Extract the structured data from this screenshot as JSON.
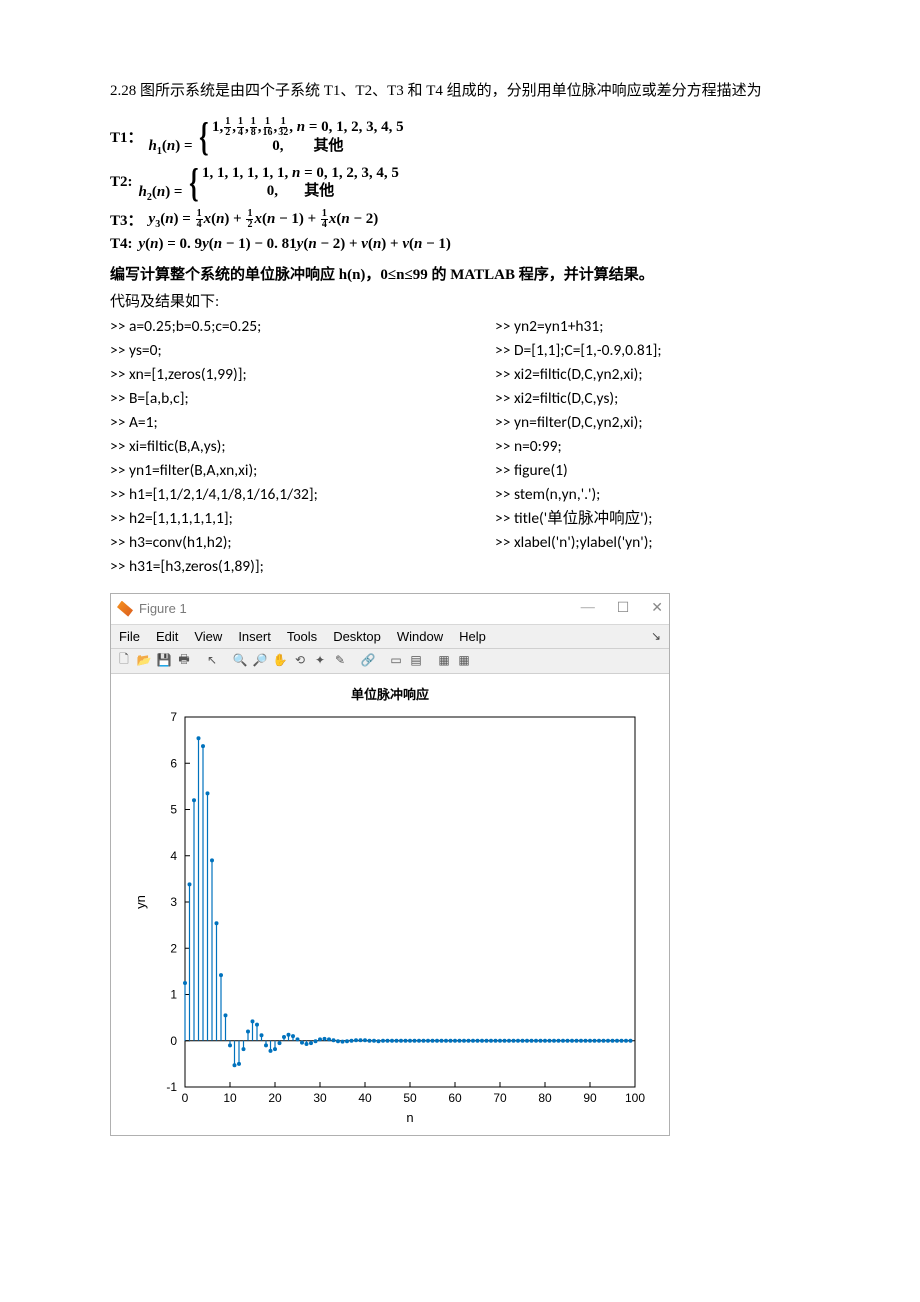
{
  "problem": {
    "statement": "2.28 图所示系统是由四个子系统 T1、T2、T3 和 T4 组成的，分别用单位脉冲响应或差分方程描述为",
    "T1_label": "T1：",
    "T1_lhs": "h₁(n) = ",
    "T1_case1": "1, ½, ¼, ⅛, 1⁄16, 1⁄32,  n = 0, 1, 2, 3, 4, 5",
    "T1_case2": "0,        其他",
    "T2_label": "T2:",
    "T2_lhs": "h₂(n) = ",
    "T2_case1": "1, 1, 1, 1, 1, 1,  n = 0, 1, 2, 3, 4, 5",
    "T2_case2": "0,        其他",
    "T3_label": "T3：",
    "T3_body": "y₃(n) = ¼x(n) + ½x(n − 1) + ¼x(n − 2)",
    "T4_label": "T4:",
    "T4_body": "y(n) = 0.9y(n − 1) − 0.81y(n − 2) + v(n) + v(n − 1)",
    "task1": "编写计算整个系统的单位脉冲响应 h(n)，0≤n≤99 的 MATLAB 程序，并计算结果。",
    "task2": "代码及结果如下:"
  },
  "code_left": [
    ">> a=0.25;b=0.5;c=0.25;",
    ">> ys=0;",
    ">> xn=[1,zeros(1,99)];",
    ">> B=[a,b,c];",
    ">> A=1;",
    ">> xi=filtic(B,A,ys);",
    ">> yn1=filter(B,A,xn,xi);",
    ">> h1=[1,1/2,1/4,1/8,1/16,1/32];",
    ">> h2=[1,1,1,1,1,1];",
    ">> h3=conv(h1,h2);",
    ">> h31=[h3,zeros(1,89)];"
  ],
  "code_right": [
    ">> yn2=yn1+h31;",
    ">> D=[1,1];C=[1,-0.9,0.81];",
    ">> xi2=filtic(D,C,yn2,xi);",
    ">> xi2=filtic(D,C,ys);",
    ">> yn=filter(D,C,yn2,xi);",
    ">> n=0:99;",
    ">> figure(1)",
    ">> stem(n,yn,'.');",
    ">> title('单位脉冲响应');",
    ">> xlabel('n');ylabel('yn');"
  ],
  "figure": {
    "window_title": "Figure 1",
    "menus": [
      "File",
      "Edit",
      "View",
      "Insert",
      "Tools",
      "Desktop",
      "Window",
      "Help"
    ],
    "toolbar_icons": [
      "new-file-icon",
      "open-icon",
      "save-icon",
      "print-icon",
      "arrow-icon",
      "zoom-in-icon",
      "zoom-out-icon",
      "pan-icon",
      "rotate-icon",
      "data-cursor-icon",
      "brush-icon",
      "link-icon",
      "colorbar-icon",
      "legend-icon",
      "sep",
      "layout-icon",
      "layout2-icon"
    ],
    "plot_title": "单位脉冲响应",
    "xlabel": "n",
    "ylabel": "yn"
  },
  "chart_data": {
    "type": "stem",
    "title": "单位脉冲响应",
    "xlabel": "n",
    "ylabel": "yn",
    "xlim": [
      0,
      100
    ],
    "ylim": [
      -1,
      7
    ],
    "xticks": [
      0,
      10,
      20,
      30,
      40,
      50,
      60,
      70,
      80,
      90,
      100
    ],
    "yticks": [
      -1,
      0,
      1,
      2,
      3,
      4,
      5,
      6,
      7
    ],
    "x": [
      0,
      1,
      2,
      3,
      4,
      5,
      6,
      7,
      8,
      9,
      10,
      11,
      12,
      13,
      14,
      15,
      16,
      17,
      18,
      19,
      20,
      21,
      22,
      23,
      24,
      25,
      26,
      27,
      28,
      29,
      30,
      31,
      32,
      33,
      34,
      35,
      36,
      37,
      38,
      39,
      40,
      41,
      42,
      43,
      44,
      45,
      46,
      47,
      48,
      49,
      50,
      51,
      52,
      53,
      54,
      55,
      56,
      57,
      58,
      59,
      60,
      61,
      62,
      63,
      64,
      65,
      66,
      67,
      68,
      69,
      70,
      71,
      72,
      73,
      74,
      75,
      76,
      77,
      78,
      79,
      80,
      81,
      82,
      83,
      84,
      85,
      86,
      87,
      88,
      89,
      90,
      91,
      92,
      93,
      94,
      95,
      96,
      97,
      98,
      99
    ],
    "y": [
      1.25,
      3.38,
      5.2,
      6.54,
      6.37,
      5.35,
      3.9,
      2.54,
      1.42,
      0.55,
      -0.1,
      -0.53,
      -0.5,
      -0.18,
      0.2,
      0.42,
      0.35,
      0.12,
      -0.1,
      -0.22,
      -0.18,
      -0.05,
      0.08,
      0.13,
      0.1,
      0.03,
      -0.04,
      -0.07,
      -0.05,
      -0.01,
      0.03,
      0.04,
      0.03,
      0.01,
      -0.01,
      -0.02,
      -0.01,
      0.0,
      0.01,
      0.01,
      0.01,
      0.0,
      0.0,
      -0.01,
      0.0,
      0.0,
      0.0,
      0.0,
      0.0,
      0.0,
      0.0,
      0.0,
      0.0,
      0.0,
      0.0,
      0.0,
      0.0,
      0.0,
      0.0,
      0.0,
      0.0,
      0.0,
      0.0,
      0.0,
      0.0,
      0.0,
      0.0,
      0.0,
      0.0,
      0.0,
      0.0,
      0.0,
      0.0,
      0.0,
      0.0,
      0.0,
      0.0,
      0.0,
      0.0,
      0.0,
      0.0,
      0.0,
      0.0,
      0.0,
      0.0,
      0.0,
      0.0,
      0.0,
      0.0,
      0.0,
      0.0,
      0.0,
      0.0,
      0.0,
      0.0,
      0.0,
      0.0,
      0.0,
      0.0,
      0.0
    ]
  }
}
